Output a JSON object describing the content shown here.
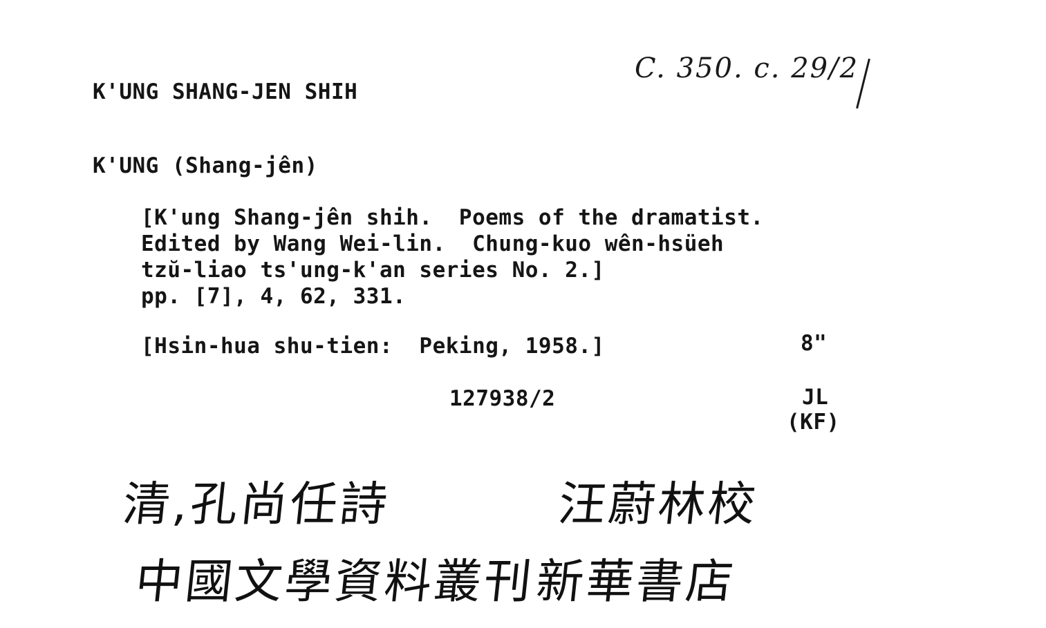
{
  "shelfmark": "C. 350. c. 29/2",
  "heading": "K'UNG SHANG-JEN SHIH",
  "author": "K'UNG (Shang-jên)",
  "description": [
    "[K'ung Shang-jên shih.  Poems of the dramatist.",
    "Edited by Wang Wei-lin.  Chung-kuo wên-hsüeh",
    "tzŭ-liao ts'ung-k'an series No. 2.]",
    "pp. [7], 4, 62, 331."
  ],
  "imprint": "[Hsin-hua shu-tien:  Peking, 1958.]",
  "size": "8\"",
  "accession_number": "127938/2",
  "cataloguer_initials": "JL",
  "cataloguer_note": "(KF)",
  "handwritten_chinese": {
    "line1_left": "清,孔尚任詩",
    "line1_right": "汪蔚林校",
    "line2_left": "中國文學資料叢刊",
    "line2_right": "新華書店"
  }
}
